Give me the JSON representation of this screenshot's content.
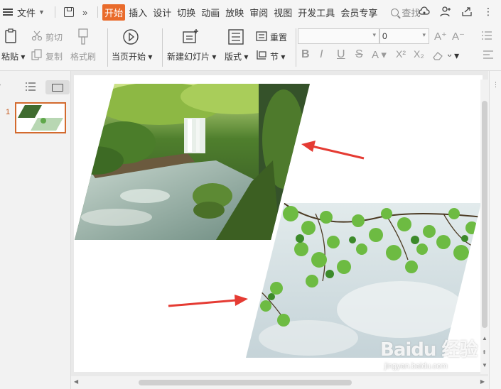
{
  "menubar": {
    "file_label": "文件",
    "tabs": [
      "开始",
      "插入",
      "设计",
      "切换",
      "动画",
      "放映",
      "审阅",
      "视图",
      "开发工具",
      "会员专享"
    ],
    "search_label": "查找"
  },
  "ribbon": {
    "paste_label": "粘贴",
    "cut_label": "剪切",
    "copy_label": "复制",
    "format_painter_label": "格式刷",
    "from_current_label": "当页开始",
    "new_slide_label": "新建幻灯片",
    "layout_label": "版式",
    "reset_label": "重置",
    "section_label": "节",
    "font_size_value": "0"
  },
  "thumbnail": {
    "number": "1"
  },
  "watermark": {
    "brand": "Baidu 经验",
    "url": "jingyan.baidu.com"
  },
  "colors": {
    "accent": "#e96b2b",
    "arrow": "#e53b33"
  }
}
